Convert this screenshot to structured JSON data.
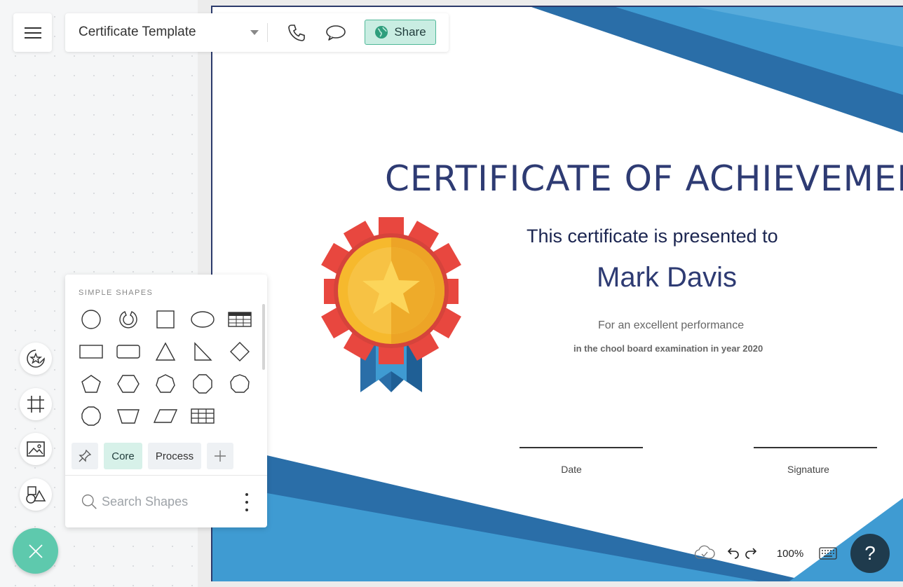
{
  "document": {
    "title": "Certificate Template"
  },
  "toolbar": {
    "share_label": "Share"
  },
  "certificate": {
    "title": "CERTIFICATE  OF ACHIEVEMENT",
    "presented_to": "This certificate is presented to",
    "recipient": "Mark Davis",
    "reason": "For an excellent performance",
    "detail": "in the chool board examination in year 2020",
    "date_label": "Date",
    "signature_label": "Signature",
    "colors": {
      "navy": "#2e3b73",
      "blue_light": "#3f9bd2",
      "blue_dark": "#2a6ea8",
      "medal_gold": "#f6b92d",
      "medal_red": "#e8473f"
    }
  },
  "shapes_panel": {
    "heading": "SIMPLE SHAPES",
    "shapes": [
      "circle",
      "partial-circle",
      "square",
      "ellipse",
      "table",
      "rectangle",
      "rounded-rectangle",
      "triangle",
      "right-triangle",
      "diamond",
      "pentagon",
      "hexagon",
      "heptagon",
      "octagon",
      "nonagon",
      "decagon",
      "trapezoid",
      "parallelogram",
      "grid"
    ],
    "tabs": [
      {
        "label": "Core",
        "active": true
      },
      {
        "label": "Process",
        "active": false
      }
    ],
    "search_placeholder": "Search Shapes"
  },
  "left_tools": [
    "sticker-icon",
    "frame-icon",
    "image-icon",
    "shapes-icon"
  ],
  "footer": {
    "zoom": "100%",
    "help": "?"
  },
  "ui_colors": {
    "accent": "#5ec9ad",
    "share_bg": "#c9ede2",
    "help_bg": "#1f3b4d"
  }
}
